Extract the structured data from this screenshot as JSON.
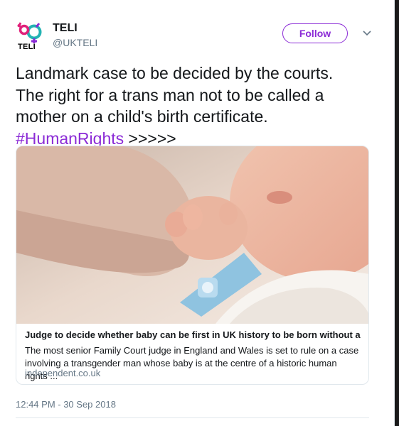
{
  "user": {
    "name": "TELI",
    "handle": "@UKTELI",
    "logo_text": "TELI"
  },
  "actions": {
    "follow_label": "Follow"
  },
  "tweet": {
    "line1": "Landmark case to be decided by the courts.",
    "line2": "The right for a trans man not to be called a",
    "line3": "mother on a child's birth certificate.",
    "hashtag": "#HumanRights",
    "arrows": " >>>>>"
  },
  "card": {
    "title": "Judge to decide whether baby can be first in UK history to be born without a ...",
    "description_line1": "The most senior Family Court judge in England and Wales is set to rule on a case",
    "description_line2": "involving a transgender man whose baby is at the centre of a historic human rights ...",
    "domain": "independent.co.uk"
  },
  "timestamp": "12:44 PM - 30 Sep 2018",
  "colors": {
    "accent": "#8b2bd6",
    "text": "#14171a",
    "muted": "#657786",
    "border": "#e1e8ed"
  }
}
